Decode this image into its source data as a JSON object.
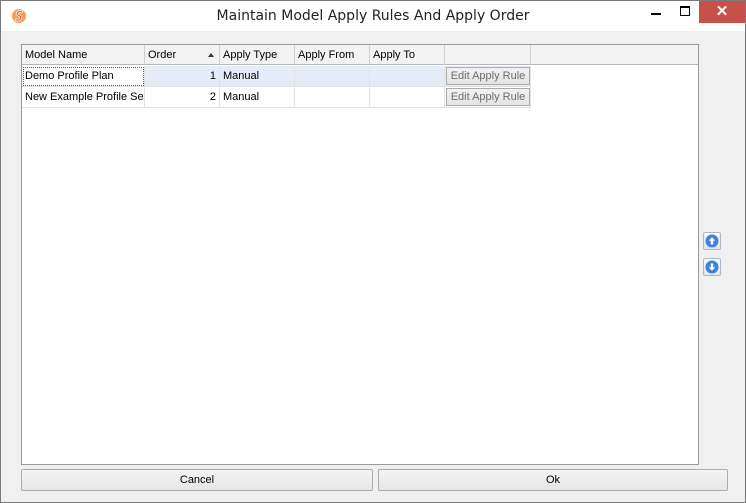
{
  "window": {
    "title": "Maintain Model Apply Rules And Apply Order",
    "icon": "app-logo-icon",
    "controls": [
      "minimize-icon",
      "maximize-icon",
      "close-icon"
    ]
  },
  "table": {
    "columns": [
      "Model Name",
      "Order",
      "Apply Type",
      "Apply From",
      "Apply To",
      ""
    ],
    "sorted_column": "Order",
    "sort_direction": "ascending",
    "rows": [
      {
        "model_name": "Demo Profile Plan",
        "order": "1",
        "apply_type": "Manual",
        "apply_from": "",
        "apply_to": "",
        "action_label": "Edit Apply Rule"
      },
      {
        "model_name": "New Example Profile Set",
        "order": "2",
        "apply_type": "Manual",
        "apply_from": "",
        "apply_to": "",
        "action_label": "Edit Apply Rule"
      }
    ]
  },
  "side_buttons": {
    "up_icon": "arrow-up-icon",
    "down_icon": "arrow-down-icon"
  },
  "footer": {
    "cancel_label": "Cancel",
    "ok_label": "Ok"
  },
  "colors": {
    "close_button": "#c7504a",
    "selected_row": "#e4ecf7",
    "arrow_icon": "#3f83d6",
    "app_icon": "#e8632a"
  }
}
